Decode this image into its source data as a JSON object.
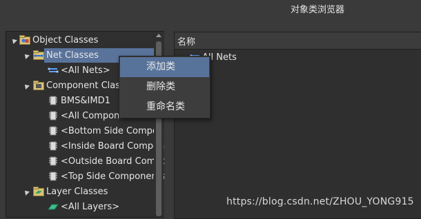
{
  "window": {
    "title": "对象类浏览器"
  },
  "tree": {
    "items": [
      {
        "label": "Object Classes",
        "icon": "object-classes-icon",
        "expanded": true
      },
      {
        "label": "Net Classes",
        "icon": "net-classes-icon",
        "expanded": true,
        "selected": true
      },
      {
        "label": "<All Nets>",
        "icon": "net-icon"
      },
      {
        "label": "Component Classes",
        "icon": "component-classes-icon",
        "expanded": true
      },
      {
        "label": "BMS&IMD1",
        "icon": "component-icon"
      },
      {
        "label": "<All Components>",
        "icon": "component-icon"
      },
      {
        "label": "<Bottom Side Components>",
        "icon": "component-icon"
      },
      {
        "label": "<Inside Board Components>",
        "icon": "component-icon"
      },
      {
        "label": "<Outside Board Components>",
        "icon": "component-icon"
      },
      {
        "label": "<Top Side Components>",
        "icon": "component-icon"
      },
      {
        "label": "Layer Classes",
        "icon": "layer-classes-icon",
        "expanded": true
      },
      {
        "label": "<All Layers>",
        "icon": "layer-icon"
      }
    ]
  },
  "list": {
    "header": "名称",
    "items": [
      {
        "label": "All Nets",
        "icon": "net-icon"
      }
    ]
  },
  "context_menu": {
    "items": [
      {
        "label": "添加类",
        "hover": true
      },
      {
        "label": "删除类"
      },
      {
        "label": "重命名类"
      }
    ]
  },
  "watermark": "https://blog.csdn.net/ZHOU_YONG915",
  "colors": {
    "selection": "#59739b",
    "panel": "#2f2f2f",
    "background": "#3a3a3a"
  }
}
